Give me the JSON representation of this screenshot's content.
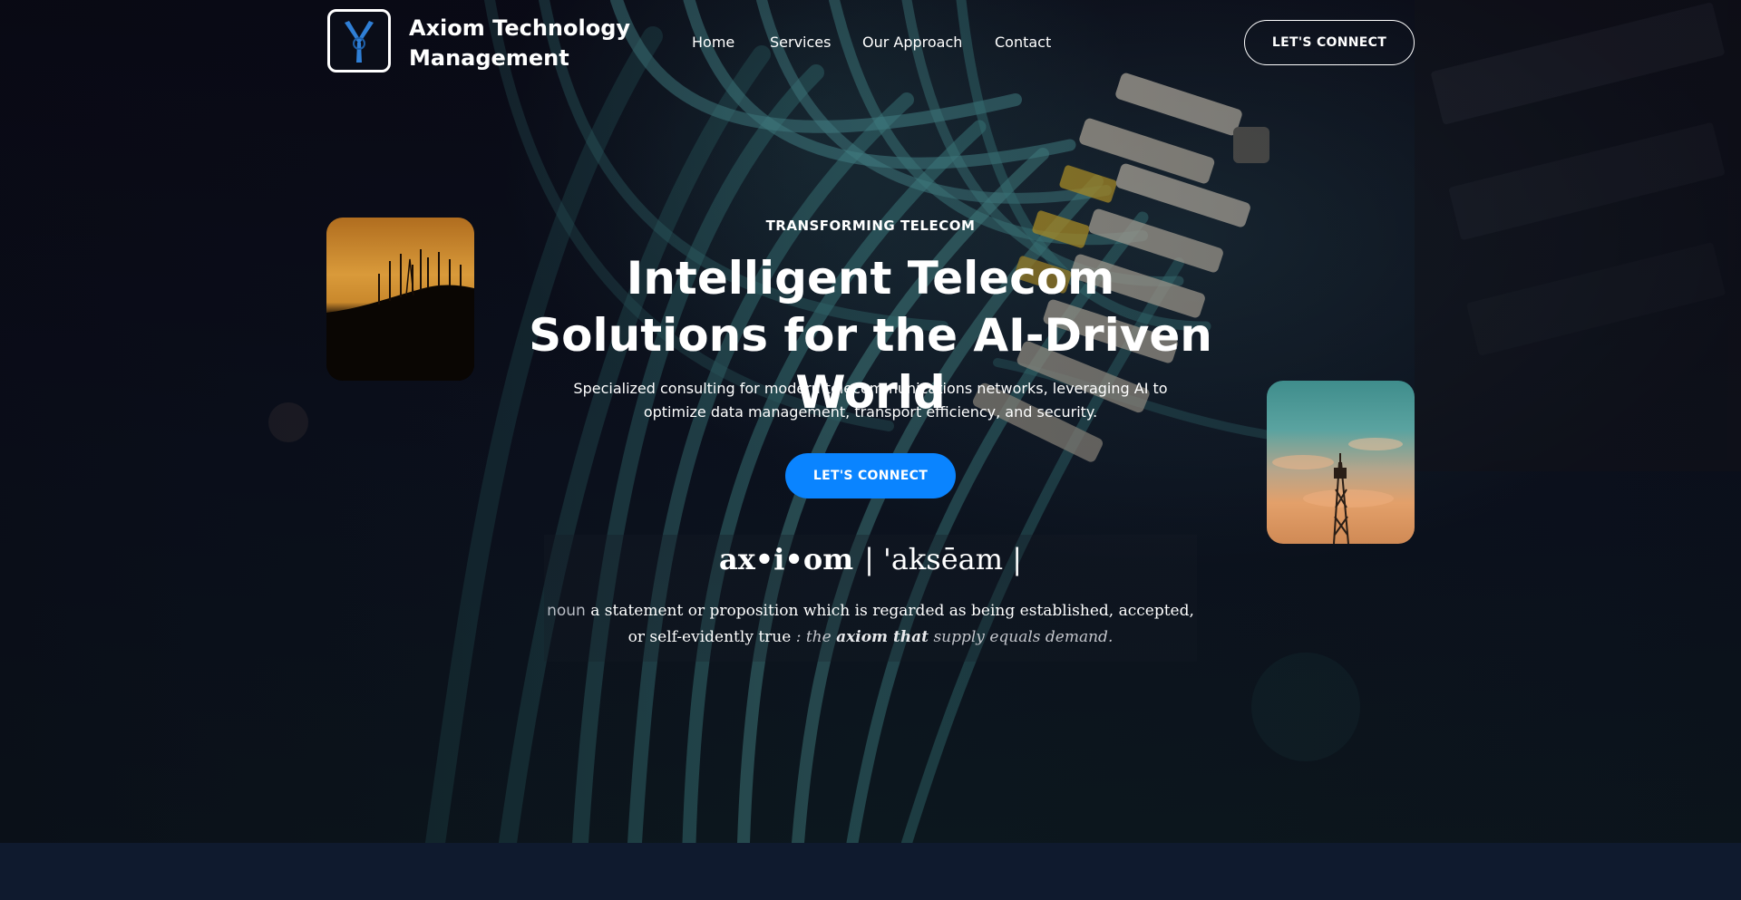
{
  "header": {
    "brand_name": "Axiom Technology Management",
    "logo_icon": "turbine-y-logo-icon",
    "nav": [
      {
        "label": "Home"
      },
      {
        "label": "Services"
      },
      {
        "label": "Our Approach"
      },
      {
        "label": "Contact"
      }
    ],
    "cta_label": "LET'S CONNECT"
  },
  "hero": {
    "eyebrow": "TRANSFORMING TELECOM",
    "headline": "Intelligent Telecom Solutions for the AI-Driven World",
    "subtext": "Specialized consulting for modern telecommunications networks, leveraging AI to optimize data management, transport efficiency, and security.",
    "cta_label": "LET'S CONNECT",
    "left_photo": "cell-towers-sunset-photo",
    "right_photo": "cell-tower-sky-photo"
  },
  "definition": {
    "word": "ax•i•om",
    "pronunciation": "| 'aksēam |",
    "part_of_speech": "noun",
    "meaning": "a statement or proposition which is regarded as being established, accepted, or self-evidently true",
    "example_prefix": ": the",
    "example_bold": "axiom that",
    "example_suffix": "supply equals demand."
  },
  "colors": {
    "accent": "#0a84ff",
    "background": "#0a0b17",
    "footer_band": "#0f1a2e",
    "text": "#ffffff"
  }
}
